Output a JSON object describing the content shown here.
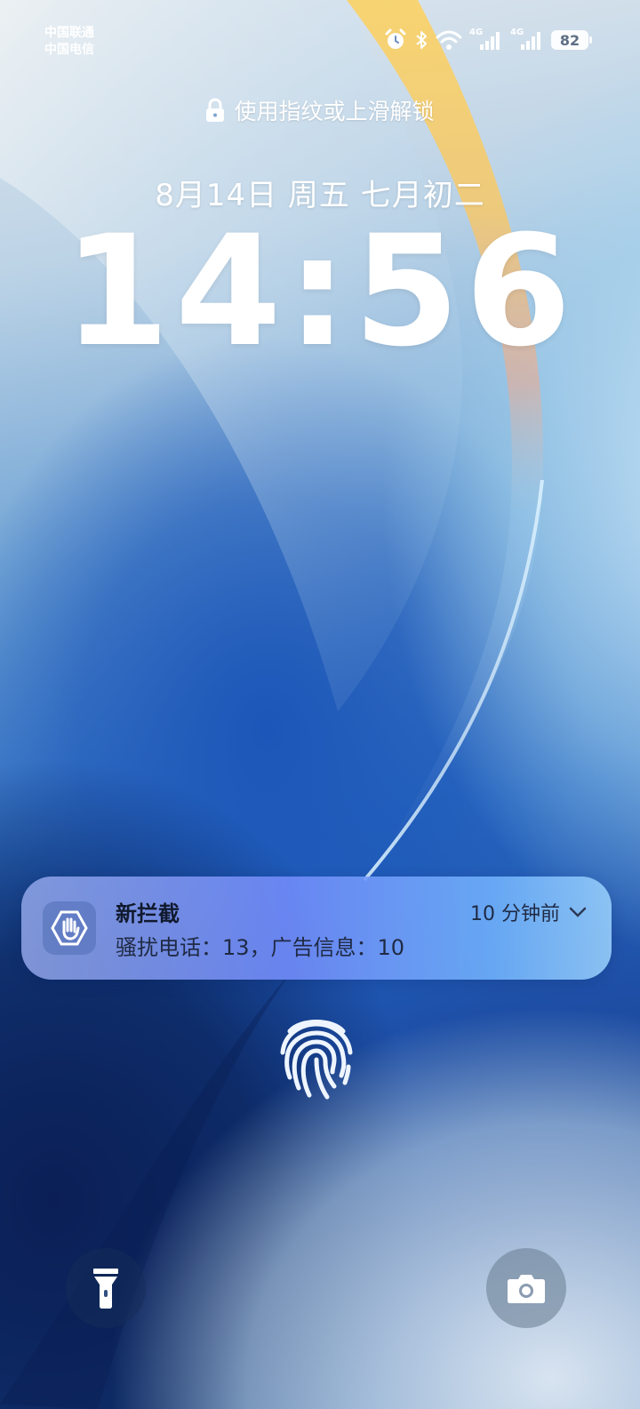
{
  "status_bar": {
    "carrier_1": "中国联通",
    "carrier_2": "中国电信",
    "icons": [
      "alarm-icon",
      "bluetooth-icon",
      "wifi-icon",
      "signal-4g-icon",
      "signal-4g-icon"
    ],
    "network_1": "4G",
    "network_2": "4G",
    "battery_level": "82"
  },
  "lock_screen": {
    "unlock_hint": "使用指纹或上滑解锁",
    "date": "8月14日 周五 七月初二",
    "time": "14:56"
  },
  "notification": {
    "title": "新拦截",
    "body": "骚扰电话：13，广告信息：10",
    "time": "10 分钟前",
    "icon": "block-hand-icon"
  },
  "bottom_actions": {
    "left_icon": "flashlight-icon",
    "right_icon": "camera-icon"
  },
  "colors": {
    "notification_accent": "#7a90f5",
    "text_primary": "#ffffff"
  }
}
